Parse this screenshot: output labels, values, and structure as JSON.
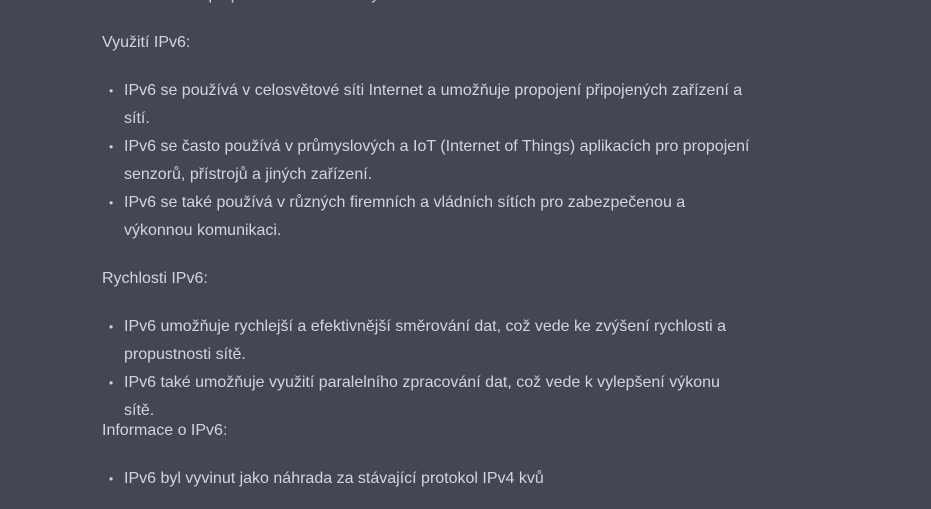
{
  "clipped_top_line": "komunikaci při přechodu mezi různými sítěmi.",
  "sections": [
    {
      "heading": "Využití IPv6:",
      "items": [
        "IPv6 se používá v celosvětové síti Internet a umožňuje propojení připojených zařízení a sítí.",
        "IPv6 se často používá v průmyslových a IoT (Internet of Things) aplikacích pro propojení senzorů, přístrojů a jiných zařízení.",
        "IPv6 se také používá v různých firemních a vládních sítích pro zabezpečenou a výkonnou komunikaci."
      ]
    },
    {
      "heading": "Rychlosti IPv6:",
      "items": [
        "IPv6 umožňuje rychlejší a efektivnější směrování dat, což vede ke zvýšení rychlosti a propustnosti sítě.",
        "IPv6 také umožňuje využití paralelního zpracování dat, což vede k vylepšení výkonu sítě."
      ]
    },
    {
      "heading": "Informace o IPv6:",
      "items": [
        "IPv6 byl vyvinut jako náhrada za stávající protokol IPv4 kvů"
      ]
    }
  ],
  "bullet_glyph": "•"
}
